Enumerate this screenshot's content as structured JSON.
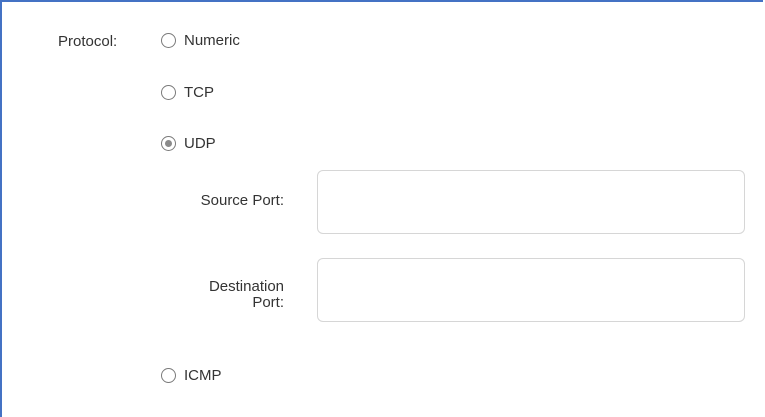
{
  "protocol": {
    "label": "Protocol:",
    "options": [
      {
        "label": "Numeric",
        "selected": false
      },
      {
        "label": "TCP",
        "selected": false
      },
      {
        "label": "UDP",
        "selected": true
      },
      {
        "label": "ICMP",
        "selected": false
      }
    ]
  },
  "udp": {
    "source_port_label": "Source Port:",
    "source_port_value": "",
    "destination_port_label_line1": "Destination",
    "destination_port_label_line2": "Port:",
    "destination_port_value": ""
  },
  "colors": {
    "border_accent": "#4472c4",
    "input_border": "#d6d6d6",
    "radio_selected_dot": "#8a8a8a"
  }
}
